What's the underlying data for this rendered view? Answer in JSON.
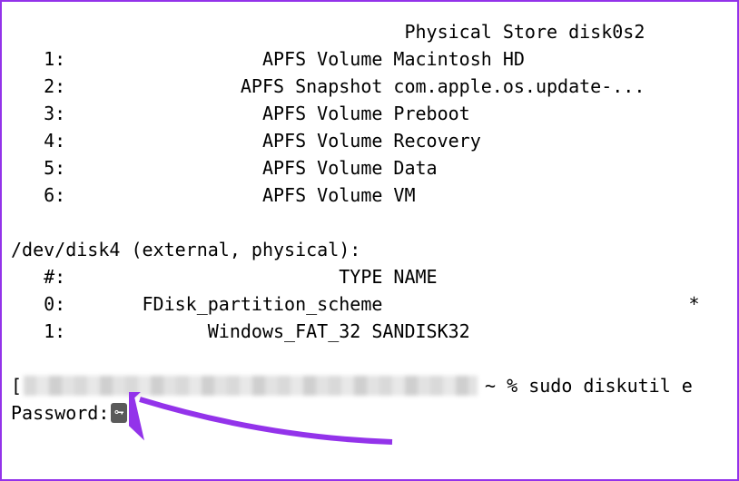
{
  "header_line": "                                    Physical Store disk0s2",
  "disk0_volumes": [
    "   1:                  APFS Volume Macintosh HD",
    "   2:                APFS Snapshot com.apple.os.update-...",
    "   3:                  APFS Volume Preboot",
    "   4:                  APFS Volume Recovery",
    "   5:                  APFS Volume Data",
    "   6:                  APFS Volume VM"
  ],
  "disk4_header": "/dev/disk4 (external, physical):",
  "disk4_cols": "   #:                         TYPE NAME",
  "disk4_rows": [
    "   0:       FDisk_partition_scheme                            *",
    "   1:             Windows_FAT_32 SANDISK32"
  ],
  "prompt_tail": "~ % sudo diskutil e",
  "password_label": "Password:"
}
